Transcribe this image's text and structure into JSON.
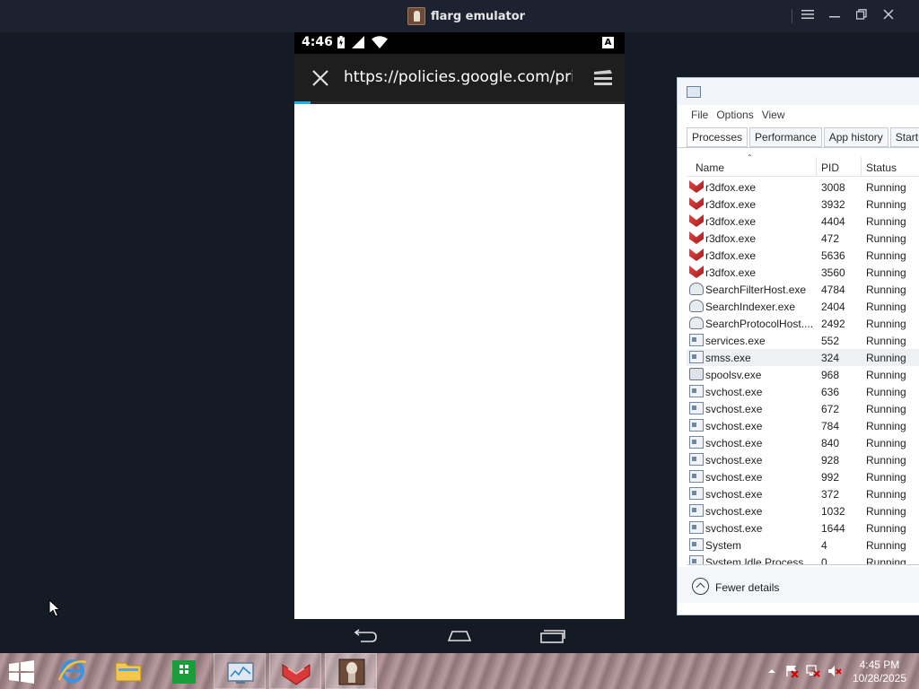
{
  "emulator": {
    "title": "flarg emulator",
    "controls": [
      "menu-icon",
      "minimize-icon",
      "restore-icon",
      "close-icon"
    ]
  },
  "phone": {
    "status": {
      "time": "4:46",
      "badge": "A"
    },
    "urlbar": {
      "url": "https://policies.google.com/privacy",
      "load_progress": 0.05
    },
    "nav": [
      "back-icon",
      "home-icon",
      "recents-icon"
    ]
  },
  "task_manager": {
    "menu": [
      "File",
      "Options",
      "View"
    ],
    "tabs": [
      {
        "label": "Processes",
        "active": true
      },
      {
        "label": "Performance",
        "active": false
      },
      {
        "label": "App history",
        "active": false
      },
      {
        "label": "Startup",
        "active": false
      }
    ],
    "columns": {
      "name": "Name",
      "pid": "PID",
      "status": "Status"
    },
    "rows": [
      {
        "name": "r3dfox.exe",
        "pid": "3008",
        "status": "Running",
        "icon": "red"
      },
      {
        "name": "r3dfox.exe",
        "pid": "3932",
        "status": "Running",
        "icon": "red"
      },
      {
        "name": "r3dfox.exe",
        "pid": "4404",
        "status": "Running",
        "icon": "red"
      },
      {
        "name": "r3dfox.exe",
        "pid": "472",
        "status": "Running",
        "icon": "red"
      },
      {
        "name": "r3dfox.exe",
        "pid": "5636",
        "status": "Running",
        "icon": "red"
      },
      {
        "name": "r3dfox.exe",
        "pid": "3560",
        "status": "Running",
        "icon": "red"
      },
      {
        "name": "SearchFilterHost.exe",
        "pid": "4784",
        "status": "Running",
        "icon": "search"
      },
      {
        "name": "SearchIndexer.exe",
        "pid": "2404",
        "status": "Running",
        "icon": "search"
      },
      {
        "name": "SearchProtocolHost....",
        "pid": "2492",
        "status": "Running",
        "icon": "search"
      },
      {
        "name": "services.exe",
        "pid": "552",
        "status": "Running",
        "icon": "win"
      },
      {
        "name": "smss.exe",
        "pid": "324",
        "status": "Running",
        "icon": "win",
        "selected": true
      },
      {
        "name": "spoolsv.exe",
        "pid": "968",
        "status": "Running",
        "icon": "printer"
      },
      {
        "name": "svchost.exe",
        "pid": "636",
        "status": "Running",
        "icon": "win"
      },
      {
        "name": "svchost.exe",
        "pid": "672",
        "status": "Running",
        "icon": "win"
      },
      {
        "name": "svchost.exe",
        "pid": "784",
        "status": "Running",
        "icon": "win"
      },
      {
        "name": "svchost.exe",
        "pid": "840",
        "status": "Running",
        "icon": "win"
      },
      {
        "name": "svchost.exe",
        "pid": "928",
        "status": "Running",
        "icon": "win"
      },
      {
        "name": "svchost.exe",
        "pid": "992",
        "status": "Running",
        "icon": "win"
      },
      {
        "name": "svchost.exe",
        "pid": "372",
        "status": "Running",
        "icon": "win"
      },
      {
        "name": "svchost.exe",
        "pid": "1032",
        "status": "Running",
        "icon": "win"
      },
      {
        "name": "svchost.exe",
        "pid": "1644",
        "status": "Running",
        "icon": "win"
      },
      {
        "name": "System",
        "pid": "4",
        "status": "Running",
        "icon": "win"
      },
      {
        "name": "System Idle Process",
        "pid": "0",
        "status": "Running",
        "icon": "win"
      }
    ],
    "footer": {
      "fewer_details": "Fewer details"
    }
  },
  "taskbar": {
    "items": [
      "start-icon",
      "internet-explorer-icon",
      "file-explorer-icon",
      "store-icon",
      "task-manager-icon",
      "r3dfox-icon",
      "flarg-emulator-icon"
    ],
    "tray_icons": [
      "show-hidden-icons-icon",
      "action-center-icon",
      "network-icon",
      "volume-muted-icon"
    ],
    "clock": {
      "time": "4:45 PM",
      "date": "10/28/2025"
    }
  },
  "colors": {
    "desktop": "#151b25",
    "phone_accent": "#1eb0e8",
    "taskmgr_border": "#b9c4d0"
  }
}
